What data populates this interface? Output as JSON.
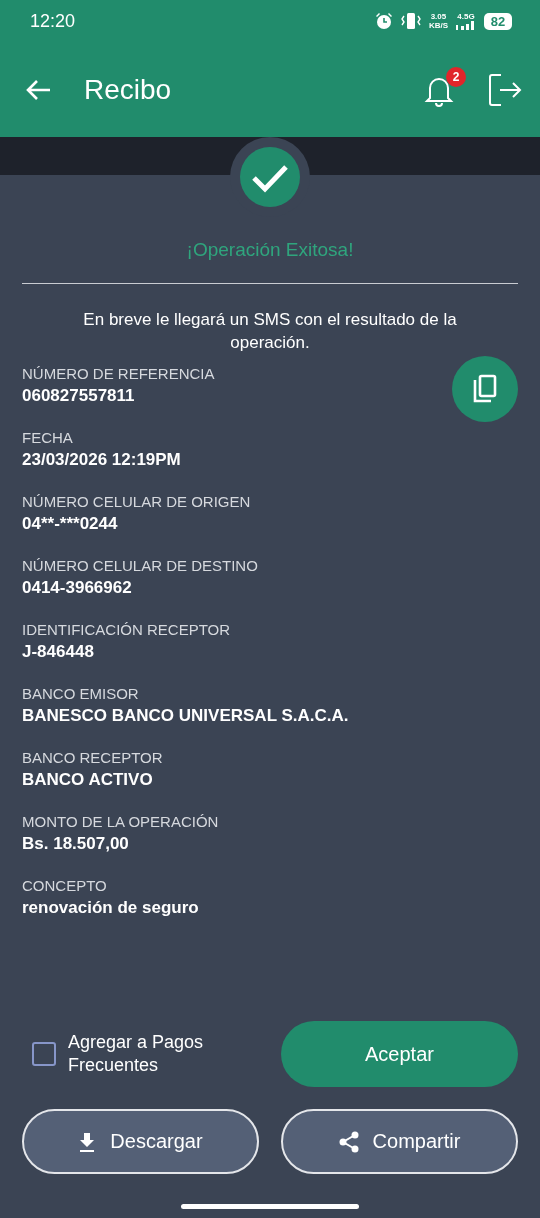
{
  "status_bar": {
    "time": "12:20",
    "speed": "3.05",
    "speed_unit": "KB/S",
    "network": "4.5G",
    "battery": "82"
  },
  "header": {
    "title": "Recibo",
    "notification_count": "2"
  },
  "result": {
    "title": "¡Operación Exitosa!",
    "message": "En breve le llegará un SMS con el resultado de la operación."
  },
  "fields": [
    {
      "label": "NÚMERO DE REFERENCIA",
      "value": "060827557811"
    },
    {
      "label": "FECHA",
      "value": "23/03/2026 12:19PM"
    },
    {
      "label": "NÚMERO CELULAR DE ORIGEN",
      "value": "04**-***0244"
    },
    {
      "label": "NÚMERO CELULAR DE DESTINO",
      "value": "0414-3966962"
    },
    {
      "label": "IDENTIFICACIÓN RECEPTOR",
      "value": "J-846448"
    },
    {
      "label": "BANCO EMISOR",
      "value": "BANESCO BANCO UNIVERSAL S.A.C.A."
    },
    {
      "label": "BANCO RECEPTOR",
      "value": "BANCO ACTIVO"
    },
    {
      "label": "MONTO DE LA OPERACIÓN",
      "value": "Bs. 18.507,00"
    },
    {
      "label": "CONCEPTO",
      "value": "renovación de seguro"
    }
  ],
  "frequent_payment": {
    "label": "Agregar a Pagos Frecuentes",
    "checked": false
  },
  "buttons": {
    "accept": "Aceptar",
    "download": "Descargar",
    "share": "Compartir"
  }
}
